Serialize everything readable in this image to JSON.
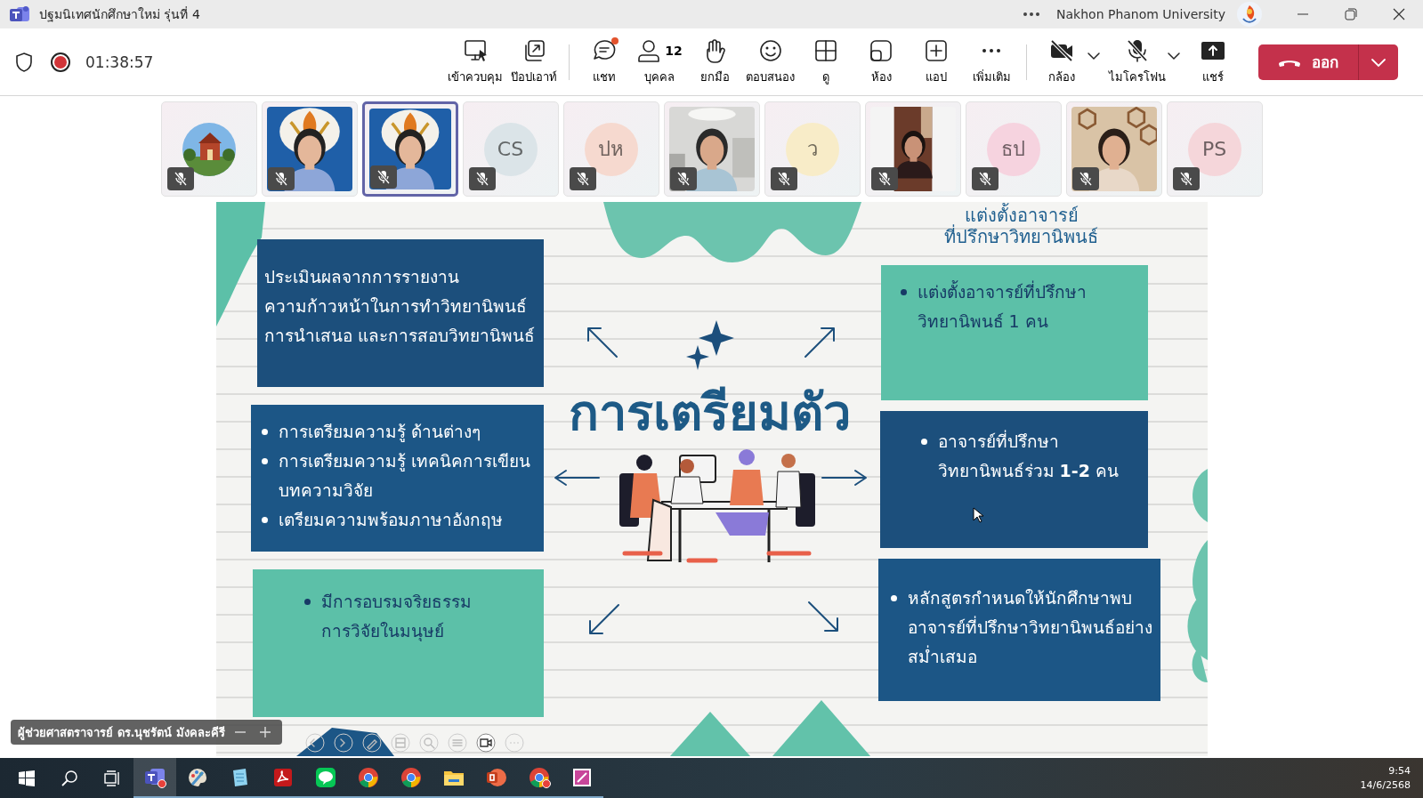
{
  "window": {
    "title": "ปฐมนิเทศนักศึกษาใหม่ รุ่นที่ 4",
    "organization": "Nakhon Phanom University"
  },
  "meeting": {
    "recording": true,
    "elapsed": "01:38:57"
  },
  "toolbar": {
    "groups": [
      [
        {
          "label": "เข้าควบคุม"
        },
        {
          "label": "ป๊อปเอาท์"
        }
      ],
      [
        {
          "label": "แชท",
          "unread": true
        },
        {
          "label": "บุคคล",
          "count": "12"
        },
        {
          "label": "ยกมือ"
        },
        {
          "label": "ตอบสนอง"
        },
        {
          "label": "ดู"
        },
        {
          "label": "ห้อง"
        },
        {
          "label": "แอป"
        },
        {
          "label": "เพิ่มเติม"
        }
      ],
      [
        {
          "label": "กล้อง",
          "dropdown": true
        },
        {
          "label": "ไมโครโฟน",
          "dropdown": true
        },
        {
          "label": "แชร์"
        }
      ]
    ],
    "leave": {
      "label": "ออก"
    }
  },
  "participants": [
    {
      "kind": "picture",
      "muted": true,
      "selected": false
    },
    {
      "kind": "video",
      "muted": true,
      "selected": false
    },
    {
      "kind": "video",
      "muted": true,
      "selected": true
    },
    {
      "kind": "initials",
      "initials": "CS",
      "color": "#dbe4e8",
      "muted": true,
      "selected": false
    },
    {
      "kind": "initials",
      "initials": "ปห",
      "color": "#f6d9cf",
      "muted": true,
      "selected": false
    },
    {
      "kind": "video",
      "muted": true,
      "selected": false
    },
    {
      "kind": "initials",
      "initials": "ว",
      "color": "#f8ecc8",
      "muted": true,
      "selected": false
    },
    {
      "kind": "video",
      "muted": true,
      "selected": false
    },
    {
      "kind": "initials",
      "initials": "ธป",
      "color": "#f6d3df",
      "muted": true,
      "selected": false
    },
    {
      "kind": "video",
      "muted": true,
      "selected": false
    },
    {
      "kind": "initials",
      "initials": "PS",
      "color": "#f5d6da",
      "muted": true,
      "selected": false
    }
  ],
  "slide": {
    "title": "การเตรียมตัว",
    "heading": "แต่งตั้งอาจารย์\nที่ปรึกษาวิทยานิพนธ์",
    "boxes": [
      {
        "kind": "paragraph",
        "color": "#1c4f7c",
        "text": "ประเมินผลจากการรายงาน\nความก้าวหน้าในการทำวิทยานิพนธ์\nการนำเสนอ และการสอบวิทยานิพนธ์"
      },
      {
        "kind": "bullets",
        "color": "#1c5686",
        "items": [
          "การเตรียมความรู้ ด้านต่างๆ",
          "การเตรียมความรู้ เทคนิคการเขียน\nบทความวิจัย",
          "เตรียมความพร้อมภาษาอังกฤษ"
        ]
      },
      {
        "kind": "bullets",
        "color": "#5cc0a8",
        "items": [
          "มีการอบรมจริยธรรม\nการวิจัยในมนุษย์"
        ]
      },
      {
        "kind": "bullets",
        "color": "#5cc0a8",
        "items": [
          "แต่งตั้งอาจารย์ที่ปรึกษา\nวิทยานิพนธ์ 1 คน"
        ]
      },
      {
        "kind": "bullets",
        "color": "#1c4f7c",
        "items": [
          "อาจารย์ที่ปรึกษา\nวิทยานิพนธ์ร่วม **1-2** คน"
        ]
      },
      {
        "kind": "bullets",
        "color": "#1c5686",
        "items": [
          "หลักสูตรกำหนดให้นักศึกษาพบ\nอาจารย์ที่ปรึกษาวิทยานิพนธ์อย่าง\nสม่ำเสมอ"
        ]
      }
    ]
  },
  "presenter": {
    "name": "ผู้ช่วยศาสตราจารย์ ดร.นุชรัตน์ มังคละคีรี"
  },
  "taskbar": {
    "apps": [
      {
        "selected": true,
        "alert": true
      },
      {
        "selected": false,
        "alert": false
      },
      {
        "selected": false,
        "alert": false
      },
      {
        "selected": false,
        "alert": false
      },
      {
        "selected": false,
        "alert": false
      },
      {
        "selected": false,
        "alert": false
      },
      {
        "selected": false,
        "alert": false
      },
      {
        "selected": false,
        "alert": false
      },
      {
        "selected": false,
        "alert": false
      },
      {
        "selected": false,
        "alert": true
      },
      {
        "selected": false,
        "alert": false
      }
    ],
    "time": "9:54",
    "date": "14/6/2568"
  }
}
